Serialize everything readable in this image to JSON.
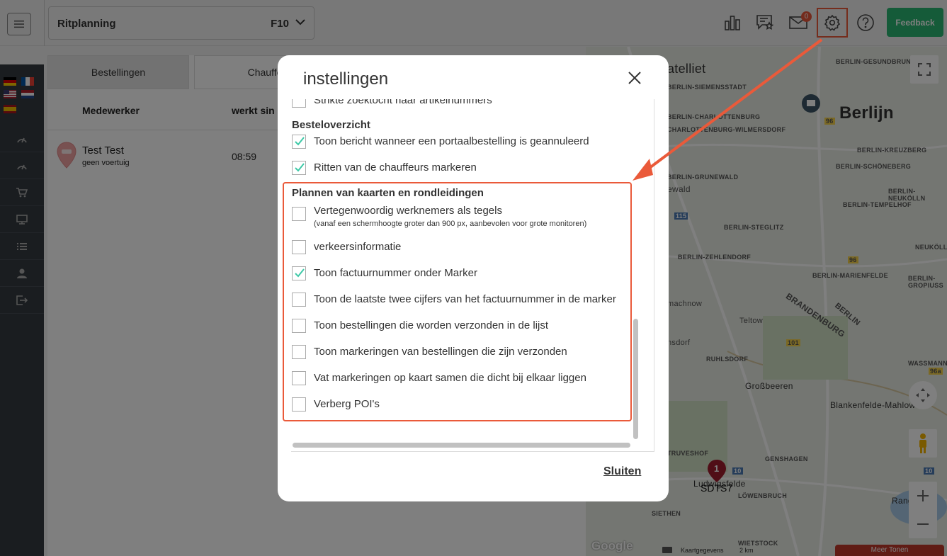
{
  "topbar": {
    "plan_label": "Ritplanning",
    "plan_value": "F10",
    "mail_badge": "0",
    "feedback_label": "Feedback"
  },
  "tabs": [
    {
      "label": "Bestellingen"
    },
    {
      "label": "Chauffe"
    }
  ],
  "table": {
    "headers": [
      "Medewerker",
      "werkt sin"
    ],
    "rows": [
      {
        "name": "Test Test",
        "sub": "geen voertuig",
        "time": "08:59"
      }
    ]
  },
  "map": {
    "satellite_label": "atelliet",
    "city_label": "Berlijn",
    "state_label": "BRANDENBURG",
    "marker_number": "1",
    "marker_label": "SDTS7",
    "google_label": "Google",
    "attribution": "Kaartgegevens",
    "scale": "2 km",
    "more_label": "Meer Tonen",
    "place_labels": [
      "BERLIN-GESUNDBRUNNEN",
      "BERLIN-SIEMENSSTADT",
      "BERLIN-CHARLOTTENBURG",
      "CHARLOTTENBURG-WILMERSDORF",
      "BERLIN-KREUZBERG",
      "BERLIN-SCHÖNEBERG",
      "BERLIN-GRUNEWALD",
      "BERLIN-NEUKÖLLN",
      "ewald",
      "BERLIN-TEMPELHOF",
      "BERLIN-STEGLITZ",
      "NEUKÖLLN",
      "BERLIN-ZEHLENDORF",
      "BERLIN-MARIENFELDE",
      "BERLIN-GROPIUSS",
      "machnow",
      "Teltow",
      "BERLIN",
      "nsdorf",
      "RUHLSDORF",
      "WASSMANNSI",
      "Großbeeren",
      "Blankenfelde-Mahlow",
      "TRUVESHOF",
      "GENSHAGEN",
      "Ludwigsfelde",
      "LÖWENBRUCH",
      "Rangsc",
      "SIETHEN",
      "WIETSTOCK"
    ],
    "road_numbers": [
      "96",
      "115",
      "96",
      "101",
      "10",
      "10",
      "96a"
    ]
  },
  "modal": {
    "title": "instellingen",
    "partial_row": "Strikte zoektocht naar artikelnummers",
    "sections": [
      {
        "title": "Besteloverzicht",
        "items": [
          {
            "label": "Toon bericht wanneer een portaalbestelling is geannuleerd",
            "checked": true
          },
          {
            "label": "Ritten van de chauffeurs markeren",
            "checked": true
          }
        ]
      },
      {
        "title": "Plannen van kaarten en rondleidingen",
        "items": [
          {
            "label": "Vertegenwoordig werknemers als tegels",
            "sub": "(vanaf een schermhoogte groter dan 900 px, aanbevolen voor grote monitoren)",
            "checked": false
          },
          {
            "label": "verkeersinformatie",
            "checked": false
          },
          {
            "label": "Toon factuurnummer onder Marker",
            "checked": true
          },
          {
            "label": "Toon de laatste twee cijfers van het factuurnummer in de marker",
            "checked": false
          },
          {
            "label": "Toon bestellingen die worden verzonden in de lijst",
            "checked": false
          },
          {
            "label": "Toon markeringen van bestellingen die zijn verzonden",
            "checked": false
          },
          {
            "label": "Vat markeringen op kaart samen die dicht bij elkaar liggen",
            "checked": false
          },
          {
            "label": "Verberg POI's",
            "checked": false
          }
        ]
      }
    ],
    "close_label": "Sluiten"
  },
  "colors": {
    "accent": "#2bb673",
    "highlight": "#ea5a3a",
    "check": "#3ec9a7",
    "sidebar": "#343a40"
  }
}
